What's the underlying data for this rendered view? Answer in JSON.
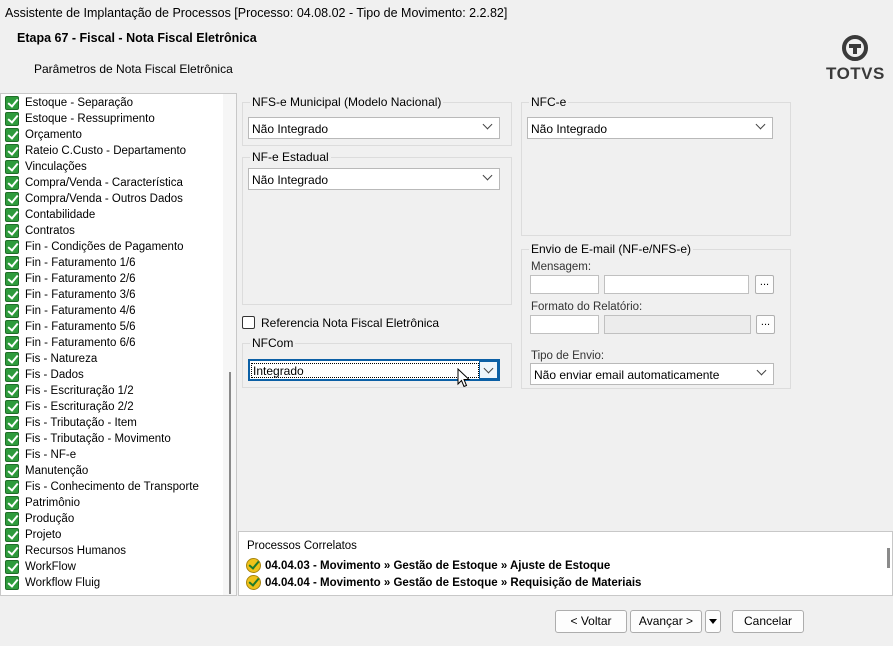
{
  "window": {
    "title": "Assistente de Implantação de Processos [Processo: 04.08.02 - Tipo de Movimento: 2.2.82]"
  },
  "header": {
    "step": "Etapa 67 - Fiscal - Nota Fiscal Eletrônica",
    "subtitle": "Parâmetros de Nota Fiscal Eletrônica",
    "logo_text": "TOTVS"
  },
  "tree": {
    "items": [
      "Estoque - Separação",
      "Estoque - Ressuprimento",
      "Orçamento",
      "Rateio C.Custo - Departamento",
      "Vinculações",
      "Compra/Venda - Característica",
      "Compra/Venda - Outros Dados",
      "Contabilidade",
      "Contratos",
      "Fin - Condições de Pagamento",
      "Fin - Faturamento 1/6",
      "Fin - Faturamento 2/6",
      "Fin - Faturamento 3/6",
      "Fin - Faturamento 4/6",
      "Fin - Faturamento 5/6",
      "Fin - Faturamento 6/6",
      "Fis - Natureza",
      "Fis - Dados",
      "Fis - Escrituração 1/2",
      "Fis - Escrituração 2/2",
      "Fis - Tributação - Item",
      "Fis - Tributação - Movimento",
      "Fis - NF-e",
      "Manutenção",
      "Fis - Conhecimento de Transporte",
      "Patrimônio",
      "Produção",
      "Projeto",
      "Recursos Humanos",
      "WorkFlow",
      "Workflow Fluig"
    ],
    "selected": "Fis - NF-e"
  },
  "form": {
    "nfse": {
      "title": "NFS-e Municipal (Modelo Nacional)",
      "value": "Não Integrado"
    },
    "nfe": {
      "title": "NF-e Estadual",
      "value": "Não Integrado"
    },
    "nfce": {
      "title": "NFC-e",
      "value": "Não Integrado"
    },
    "referencia": {
      "label": "Referencia Nota Fiscal Eletrônica",
      "checked": false
    },
    "nfcom": {
      "title": "NFCom",
      "value": "Integrado"
    },
    "email": {
      "title": "Envio de E-mail (NF-e/NFS-e)",
      "mensagem_label": "Mensagem:",
      "formato_label": "Formato do Relatório:",
      "tipo_label": "Tipo de Envio:",
      "tipo_value": "Não enviar email automaticamente",
      "browse_label": "..."
    }
  },
  "correlated": {
    "title": "Processos Correlatos",
    "items": [
      "04.04.03 - Movimento » Gestão de Estoque » Ajuste de Estoque",
      "04.04.04 - Movimento » Gestão de Estoque » Requisição de Materiais"
    ]
  },
  "footer": {
    "back": "< Voltar",
    "next": "Avançar >",
    "cancel": "Cancelar"
  }
}
